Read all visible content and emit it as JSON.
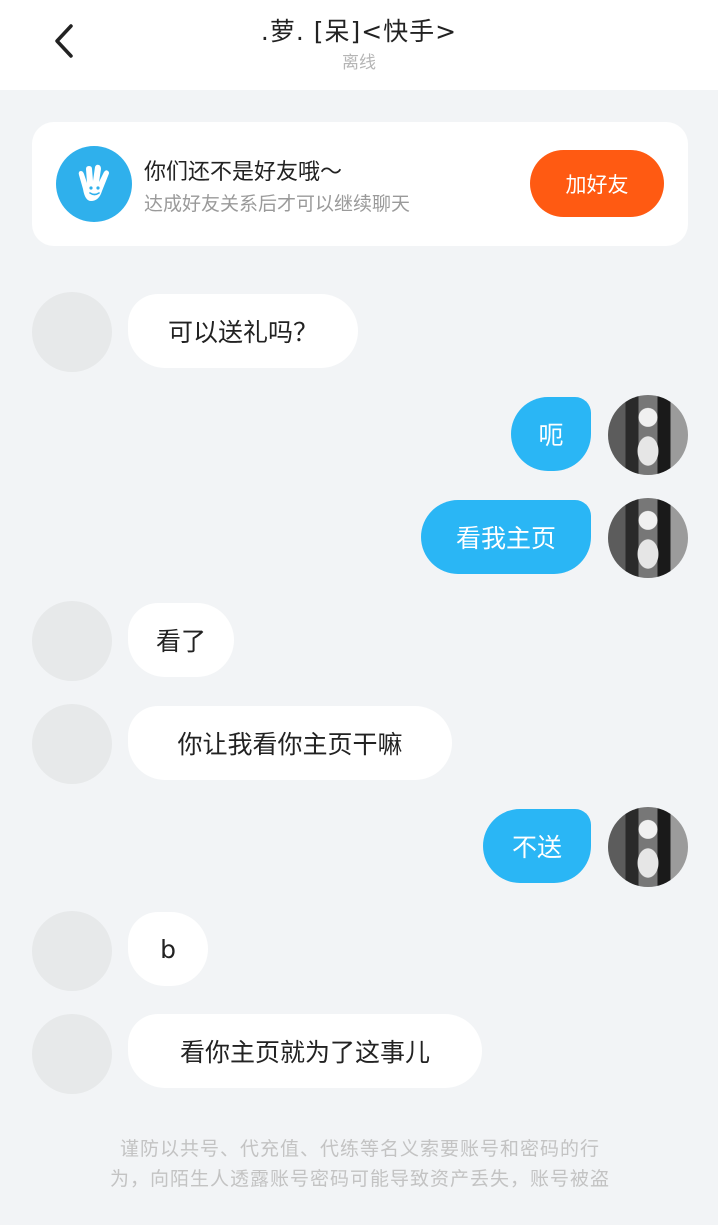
{
  "header": {
    "title": ".萝.  [呆]<快手>",
    "status": "离线",
    "back_icon": "chevron-left-icon"
  },
  "notice": {
    "icon": "hand-wave-icon",
    "title": "你们还不是好友哦～",
    "subtitle": "达成好友关系后才可以继续聊天",
    "button_label": "加好友",
    "colors": {
      "icon_bg": "#2fb0ec",
      "button_bg": "#ff5a12"
    }
  },
  "messages": [
    {
      "side": "in",
      "text": "可以送礼吗？"
    },
    {
      "side": "out",
      "text": "呃"
    },
    {
      "side": "out",
      "text": "看我主页"
    },
    {
      "side": "in",
      "text": "看了"
    },
    {
      "side": "in",
      "text": "你让我看你主页干嘛"
    },
    {
      "side": "out",
      "text": "不送"
    },
    {
      "side": "in",
      "text": "b"
    },
    {
      "side": "in",
      "text": "看你主页就为了这事儿"
    }
  ],
  "footer": {
    "line1": "谨防以共号、代充值、代练等名义索要账号和密码的行",
    "line2": "为，向陌生人透露账号密码可能导致资产丢失，账号被盗"
  },
  "colors": {
    "background": "#f2f4f6",
    "outgoing_bubble": "#2ab6f5",
    "incoming_bubble": "#ffffff"
  }
}
